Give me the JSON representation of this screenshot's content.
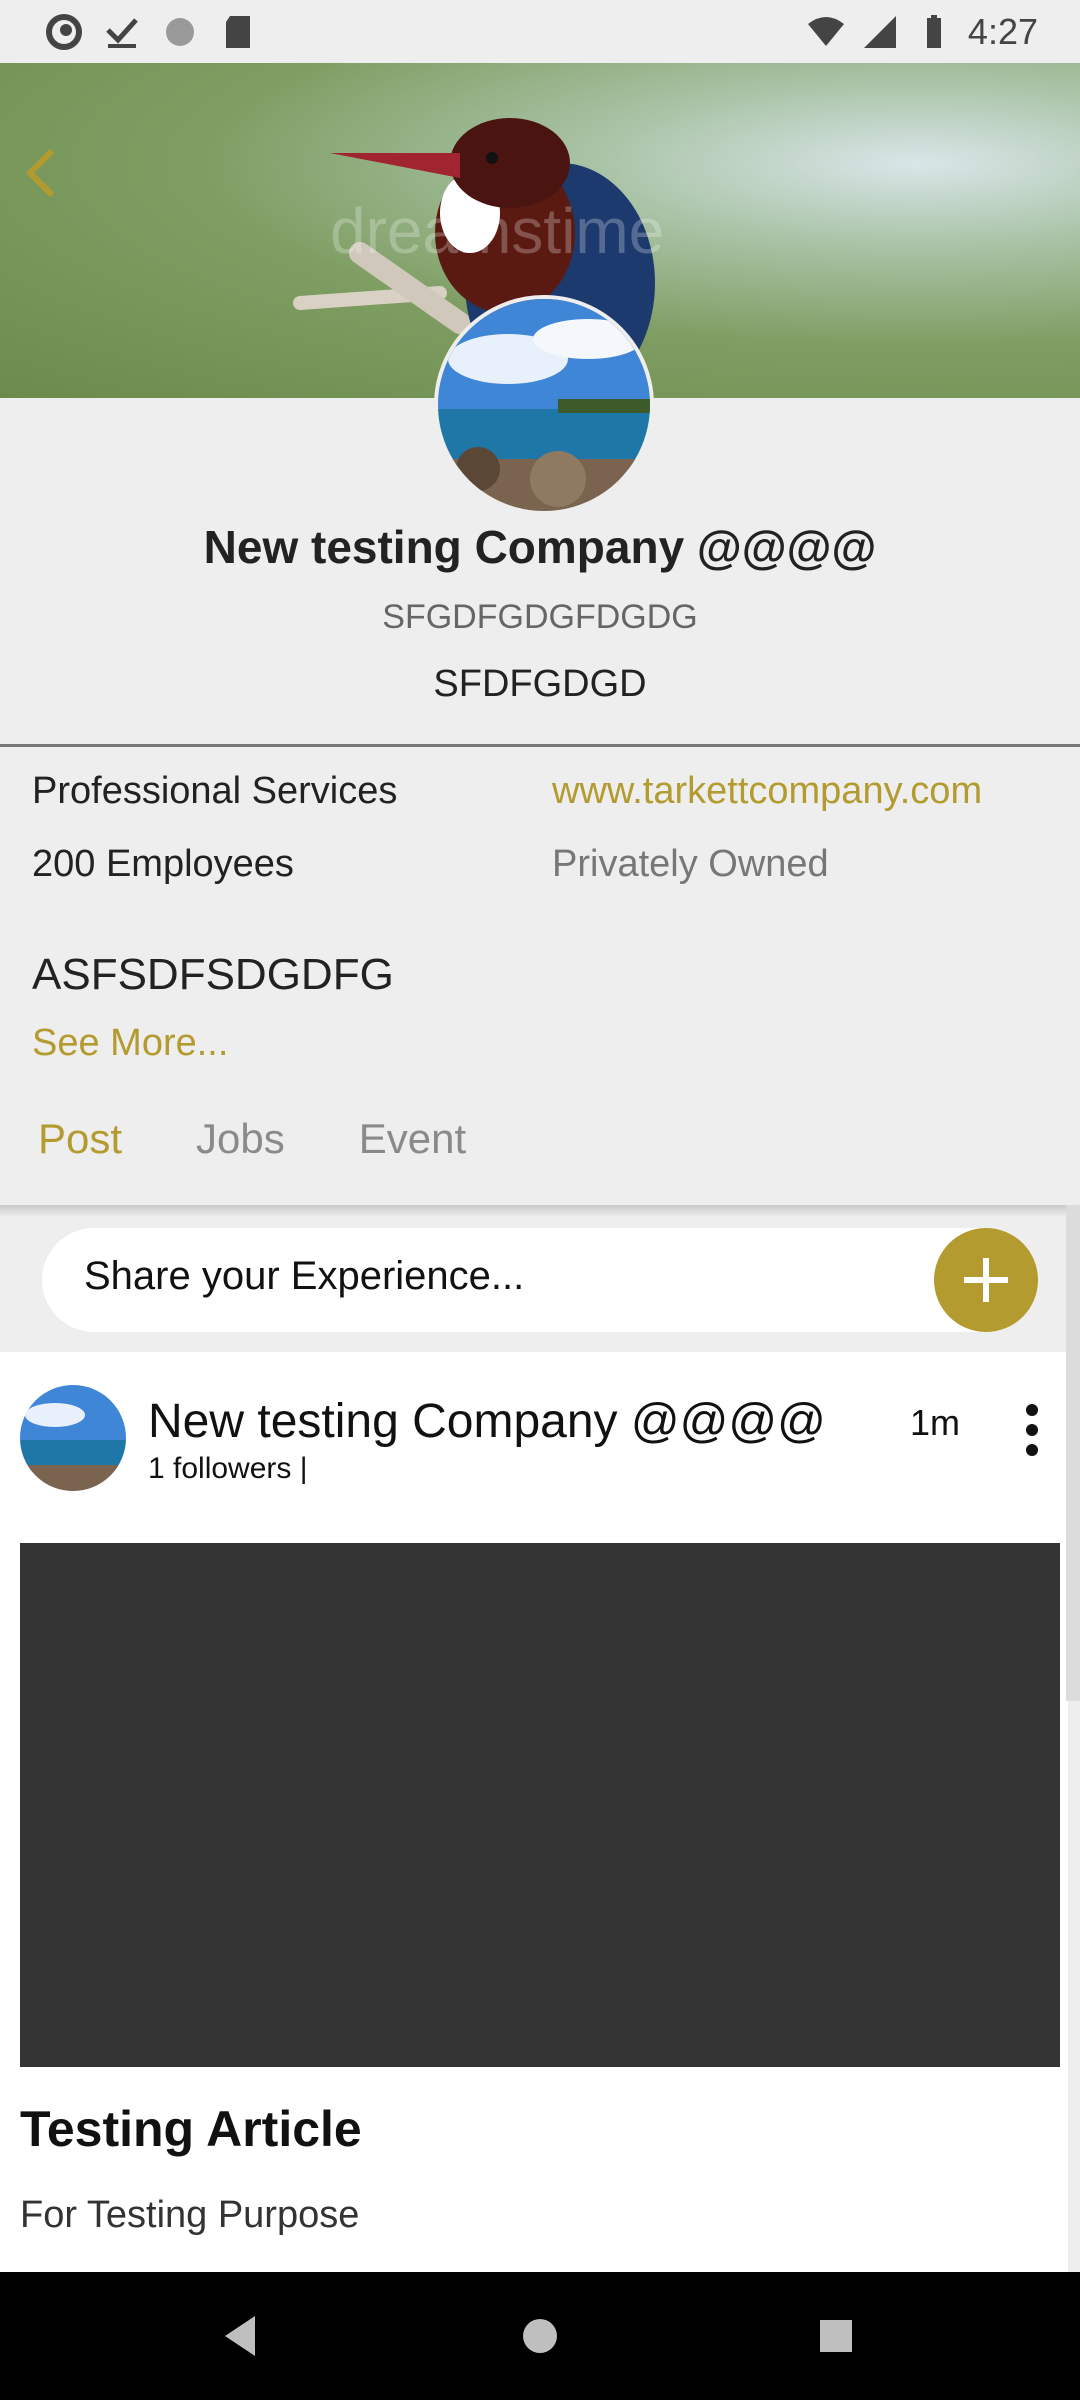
{
  "status_bar": {
    "time": "4:27",
    "icons": [
      "sync-icon",
      "download-done-icon",
      "loading-icon",
      "sd-card-icon",
      "wifi-icon",
      "signal-icon",
      "battery-icon"
    ]
  },
  "cover": {
    "watermark": "dreamstime"
  },
  "company": {
    "name": "New testing Company @@@@",
    "code": "SFGDFGDGFDGDG",
    "tagline": "SFDFGDGD"
  },
  "info": {
    "industry": "Professional Services",
    "website": "www.tarkettcompany.com",
    "employees": "200 Employees",
    "ownership": "Privately Owned"
  },
  "description": {
    "text": "ASFSDFSDGDFG",
    "see_more": "See More..."
  },
  "tabs": {
    "active": "Post",
    "items": [
      "Post",
      "Jobs",
      "Event"
    ]
  },
  "share": {
    "placeholder": "Share your Experience..."
  },
  "post": {
    "author": "New testing Company @@@@",
    "followers": "1 followers |",
    "time": "1m",
    "title": "Testing Article",
    "subtitle": "For Testing Purpose"
  },
  "colors": {
    "accent": "#b39b2f",
    "background": "#eeeeee",
    "media": "#333333"
  }
}
